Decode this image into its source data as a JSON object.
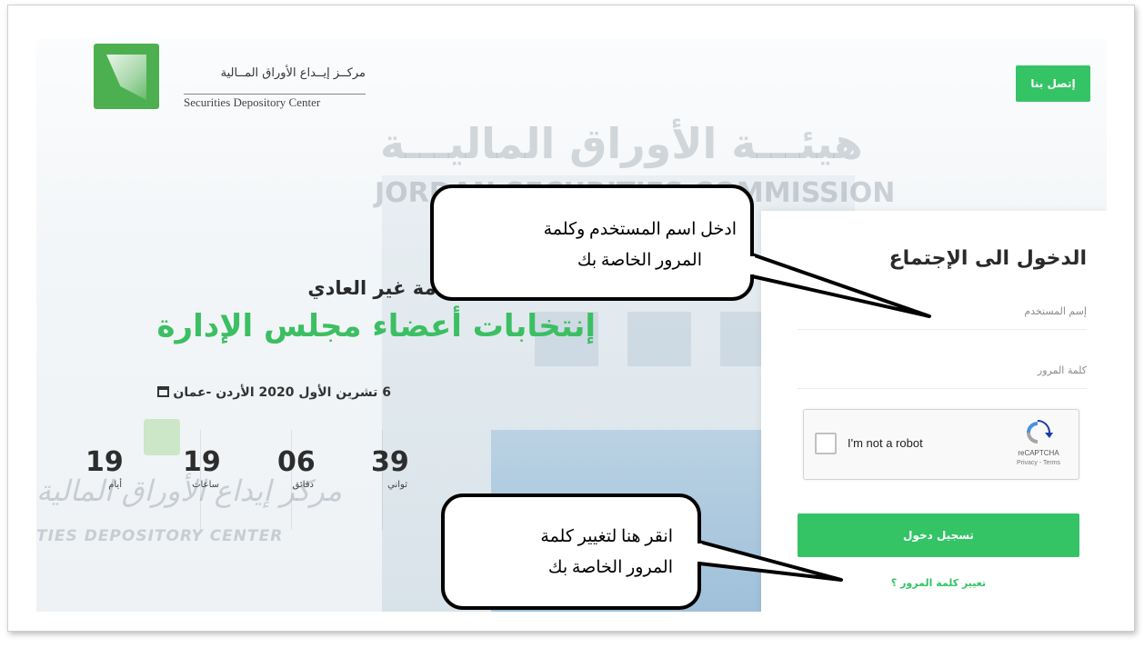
{
  "header": {
    "logo_ar": "مركــز إيــداع الأوراق المــالية",
    "logo_en": "Securities Depository Center",
    "contact_label": "إتصل بنا"
  },
  "background": {
    "watermark_ar": "هيئـــة الأوراق الماليـــة",
    "watermark_en": "JORDAN SECURITIES COMMISSION",
    "watermark_bottom_ar": "مركز إيداع الأوراق المالية",
    "watermark_bottom_en": "TIES DEPOSITORY CENTER"
  },
  "hero": {
    "subtitle": "إجتماع الهيئة العامة غير العادي",
    "title": "إنتخابات أعضاء مجلس الإدارة",
    "date": "6 تشرين الأول 2020 الأردن -عمان"
  },
  "countdown": {
    "days": {
      "value": "19",
      "label": "أيام"
    },
    "hours": {
      "value": "19",
      "label": "ساعات"
    },
    "minutes": {
      "value": "06",
      "label": "دقائق"
    },
    "seconds": {
      "value": "39",
      "label": "ثواني"
    }
  },
  "login": {
    "title": "الدخول الى الإجتماع",
    "username_placeholder": "إسم المستخدم",
    "password_placeholder": "كلمة المرور",
    "captcha_label": "I'm not a robot",
    "captcha_brand": "reCAPTCHA",
    "captcha_terms": "Privacy - Terms",
    "submit_label": "تسجيل دخول",
    "forgot_label": "تغيير كلمة المرور ؟"
  },
  "callouts": {
    "top_line1": "ادخل اسم المستخدم وكلمة",
    "top_line2": "المرور الخاصة بك",
    "bottom_line1": "انقر هنا لتغيير كلمة",
    "bottom_line2": "المرور الخاصة بك"
  },
  "colors": {
    "accent_green": "#34c466",
    "title_green": "#3cbf63"
  },
  "icons": {
    "calendar": "calendar-icon",
    "recaptcha": "recaptcha-icon",
    "logo": "sdc-logo-icon"
  }
}
